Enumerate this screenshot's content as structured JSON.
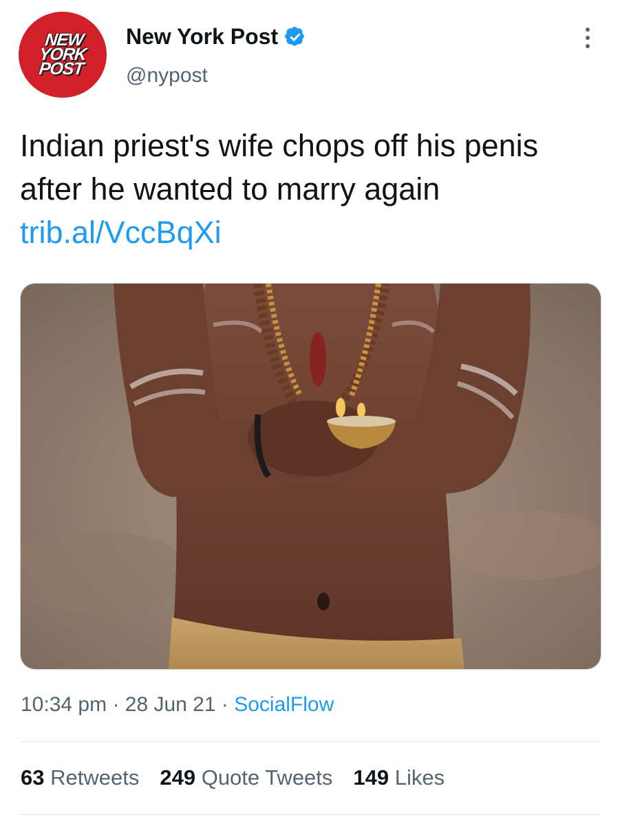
{
  "account": {
    "logo_text": "NEW YORK POST",
    "display_name": "New York Post",
    "handle": "@nypost",
    "verified": true,
    "brand_color": "#d1202a"
  },
  "tweet": {
    "text": "Indian priest's wife chops off his penis after he wanted to marry again",
    "link": "trib.al/VccBqXi"
  },
  "meta": {
    "time": "10:34 pm",
    "date": "28 Jun 21",
    "source": "SocialFlow"
  },
  "stats": {
    "retweets_count": "63",
    "retweets_label": "Retweets",
    "quotes_count": "249",
    "quotes_label": "Quote Tweets",
    "likes_count": "149",
    "likes_label": "Likes"
  },
  "colors": {
    "link": "#1d9bf0",
    "secondary_text": "#536471"
  }
}
